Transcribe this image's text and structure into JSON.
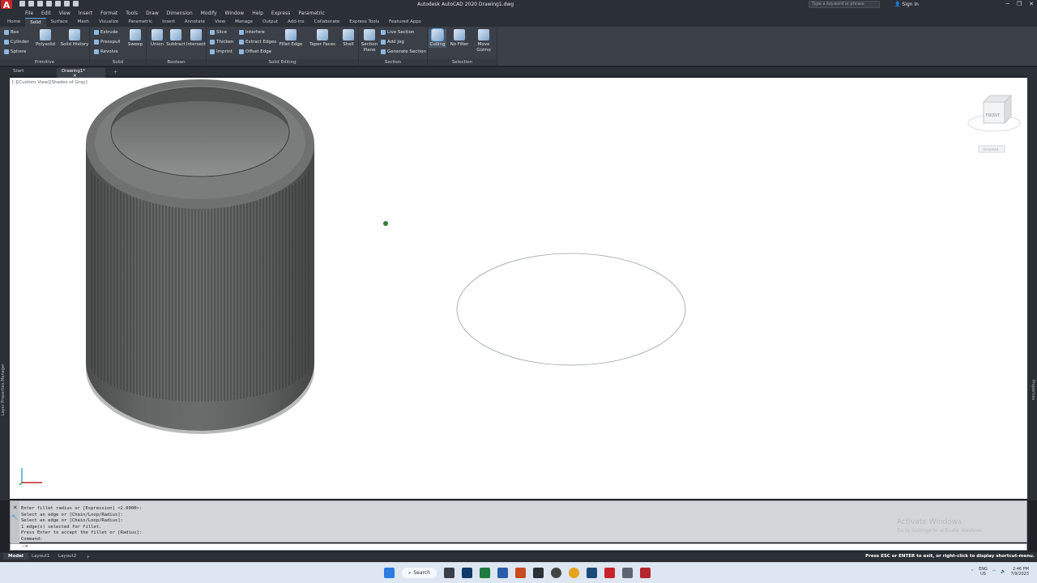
{
  "titlebar": {
    "app_logo": "A",
    "title": "Autodesk AutoCAD 2020    Drawing1.dwg",
    "search_placeholder": "Type a keyword or phrase",
    "sign_in": "Sign In"
  },
  "menu": [
    "File",
    "Edit",
    "View",
    "Insert",
    "Format",
    "Tools",
    "Draw",
    "Dimension",
    "Modify",
    "Window",
    "Help",
    "Express",
    "Parametric"
  ],
  "ribbon_tabs": [
    "Home",
    "Solid",
    "Surface",
    "Mesh",
    "Visualize",
    "Parametric",
    "Insert",
    "Annotate",
    "View",
    "Manage",
    "Output",
    "Add-ins",
    "Collaborate",
    "Express Tools",
    "Featured Apps"
  ],
  "ribbon": {
    "primitive": {
      "title": "Primitive",
      "box": "Box",
      "cylinder": "Cylinder",
      "sphere": "Sphere",
      "polysolid": "Polysolid"
    },
    "solid": {
      "title": "Solid",
      "solid_history": "Solid History",
      "extrude": "Extrude",
      "presspull": "Presspull",
      "revolve": "Revolve",
      "sweep": "Sweep"
    },
    "boolean": {
      "title": "Boolean",
      "union": "Union",
      "subtract": "Subtract",
      "intersect": "Intersect"
    },
    "solid_editing": {
      "title": "Solid Editing",
      "slice": "Slice",
      "thicken": "Thicken",
      "imprint": "Imprint",
      "interfere": "Interfere",
      "extract_edges": "Extract Edges",
      "offset_edge": "Offset Edge",
      "fillet_edge": "Fillet Edge",
      "taper_faces": "Taper Faces",
      "shell": "Shell"
    },
    "section": {
      "title": "Section",
      "section_plane": "Section Plane",
      "live_section": "Live Section",
      "add_jog": "Add Jog",
      "generate_section": "Generate Section"
    },
    "selection": {
      "title": "Selection",
      "culling": "Culling",
      "no_filter": "No Filter",
      "move_gizmo": "Move Gizmo"
    }
  },
  "file_tabs": [
    "Start",
    "Drawing1*"
  ],
  "viewport": {
    "label": "[-][Custom View][Shades of Gray]",
    "viewcube_face": "FRONT",
    "unnamed": "Unnamed",
    "left_palette": "Layer Properties Manager",
    "right_palette": "Properties"
  },
  "command_history": [
    "Enter fillet radius or [Expression] <2.0000>:",
    "Select an edge or [Chain/Loop/Radius]:",
    "Select an edge or [Chain/Loop/Radius]:",
    "1 edge(s) selected for fillet.",
    "Press Enter to accept the fillet or [Radius]:",
    "Command:"
  ],
  "watermark": {
    "line1": "Activate Windows",
    "line2": "Go to Settings to activate Windows."
  },
  "layout_tabs": [
    "Model",
    "Layout1",
    "Layout2"
  ],
  "status_message": "Press ESC or ENTER to exit, or right-click to display shortcut-menu.",
  "taskbar": {
    "search": "Search",
    "lang": "ENG",
    "region": "US",
    "time": "2:46 PM",
    "date": "7/9/2023"
  },
  "colors": {
    "autocad_red": "#c8242b",
    "ribbon_bg": "#3b4048",
    "canvas_bg": "#ffffff",
    "solid_gray": "#5c5f5e"
  }
}
